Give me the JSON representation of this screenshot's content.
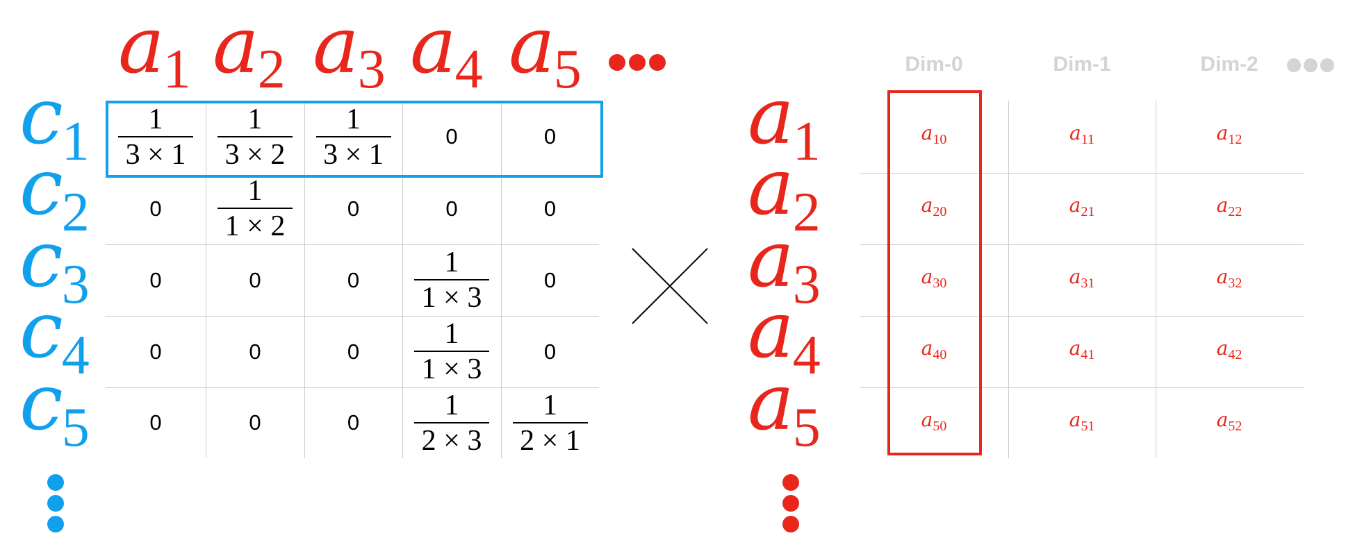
{
  "left_matrix": {
    "col_headers": [
      {
        "base": "a",
        "sub": "1"
      },
      {
        "base": "a",
        "sub": "2"
      },
      {
        "base": "a",
        "sub": "3"
      },
      {
        "base": "a",
        "sub": "4"
      },
      {
        "base": "a",
        "sub": "5"
      }
    ],
    "row_headers": [
      {
        "base": "c",
        "sub": "1"
      },
      {
        "base": "c",
        "sub": "2"
      },
      {
        "base": "c",
        "sub": "3"
      },
      {
        "base": "c",
        "sub": "4"
      },
      {
        "base": "c",
        "sub": "5"
      }
    ],
    "cells": [
      [
        {
          "num": "1",
          "den": "3 × 1"
        },
        {
          "num": "1",
          "den": "3 × 2"
        },
        {
          "num": "1",
          "den": "3 × 1"
        },
        "0",
        "0"
      ],
      [
        "0",
        {
          "num": "1",
          "den": "1 × 2"
        },
        "0",
        "0",
        "0"
      ],
      [
        "0",
        "0",
        "0",
        {
          "num": "1",
          "den": "1 × 3"
        },
        "0"
      ],
      [
        "0",
        "0",
        "0",
        {
          "num": "1",
          "den": "1 × 3"
        },
        "0"
      ],
      [
        "0",
        "0",
        "0",
        {
          "num": "1",
          "den": "2 × 3"
        },
        {
          "num": "1",
          "den": "2 × 1"
        }
      ]
    ]
  },
  "right_matrix": {
    "dim_headers": [
      "Dim-0",
      "Dim-1",
      "Dim-2"
    ],
    "row_headers": [
      {
        "base": "a",
        "sub": "1"
      },
      {
        "base": "a",
        "sub": "2"
      },
      {
        "base": "a",
        "sub": "3"
      },
      {
        "base": "a",
        "sub": "4"
      },
      {
        "base": "a",
        "sub": "5"
      }
    ],
    "cells": [
      [
        {
          "base": "a",
          "sub": "10"
        },
        {
          "base": "a",
          "sub": "11"
        },
        {
          "base": "a",
          "sub": "12"
        }
      ],
      [
        {
          "base": "a",
          "sub": "20"
        },
        {
          "base": "a",
          "sub": "21"
        },
        {
          "base": "a",
          "sub": "22"
        }
      ],
      [
        {
          "base": "a",
          "sub": "30"
        },
        {
          "base": "a",
          "sub": "31"
        },
        {
          "base": "a",
          "sub": "32"
        }
      ],
      [
        {
          "base": "a",
          "sub": "40"
        },
        {
          "base": "a",
          "sub": "41"
        },
        {
          "base": "a",
          "sub": "42"
        }
      ],
      [
        {
          "base": "a",
          "sub": "50"
        },
        {
          "base": "a",
          "sub": "51"
        },
        {
          "base": "a",
          "sub": "52"
        }
      ]
    ]
  },
  "operator": "multiply-cross-icon",
  "colors": {
    "red": "#e8261b",
    "blue": "#10a0ec",
    "grid": "#cccccc",
    "dim_header": "#d4d4d4"
  },
  "icons": [
    "ellipsis-horizontal-icon",
    "ellipsis-vertical-icon"
  ]
}
